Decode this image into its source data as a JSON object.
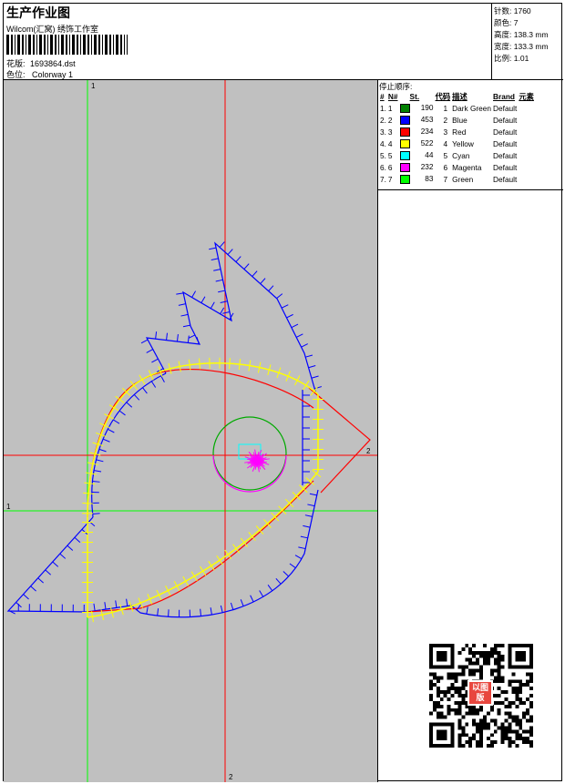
{
  "header": {
    "title": "生产作业图",
    "company": "Wilcom(汇窝) 绣饰工作室",
    "design_label": "花版:",
    "design_value": "1693864.dst",
    "colorway_label": "色位:",
    "colorway_value": "Colorway 1"
  },
  "stats": {
    "stitches_label": "针数:",
    "stitches_value": "1760",
    "colors_label": "颜色:",
    "colors_value": "7",
    "height_label": "高度:",
    "height_value": "138.3 mm",
    "width_label": "宽度:",
    "width_value": "133.3 mm",
    "scale_label": "比例:",
    "scale_value": "1.01"
  },
  "sequence": {
    "title": "停止顺序:",
    "columns": [
      "#",
      "N#",
      "St.",
      "代码",
      "描述",
      "Brand",
      "元素"
    ],
    "rows": [
      {
        "idx": "1.",
        "n": "1",
        "st": "190",
        "code": "1",
        "desc": "Dark Green",
        "brand": "Default",
        "color": "#008000"
      },
      {
        "idx": "2.",
        "n": "2",
        "st": "453",
        "code": "2",
        "desc": "Blue",
        "brand": "Default",
        "color": "#0000ff"
      },
      {
        "idx": "3.",
        "n": "3",
        "st": "234",
        "code": "3",
        "desc": "Red",
        "brand": "Default",
        "color": "#ff0000"
      },
      {
        "idx": "4.",
        "n": "4",
        "st": "522",
        "code": "4",
        "desc": "Yellow",
        "brand": "Default",
        "color": "#ffff00"
      },
      {
        "idx": "5.",
        "n": "5",
        "st": "44",
        "code": "5",
        "desc": "Cyan",
        "brand": "Default",
        "color": "#00ffff"
      },
      {
        "idx": "6.",
        "n": "6",
        "st": "232",
        "code": "6",
        "desc": "Magenta",
        "brand": "Default",
        "color": "#ff00ff"
      },
      {
        "idx": "7.",
        "n": "7",
        "st": "83",
        "code": "7",
        "desc": "Green",
        "brand": "Default",
        "color": "#00ff00"
      }
    ]
  },
  "canvas": {
    "background": "#c0c0c0",
    "axis1_color": "#00ff00",
    "axis2_color": "#ff0000",
    "axis1_label": "1",
    "axis2_label": "2"
  },
  "seal": {
    "text": "以图版"
  },
  "icons": {
    "barcode": "barcode-icon",
    "qr": "qr-code-icon"
  }
}
